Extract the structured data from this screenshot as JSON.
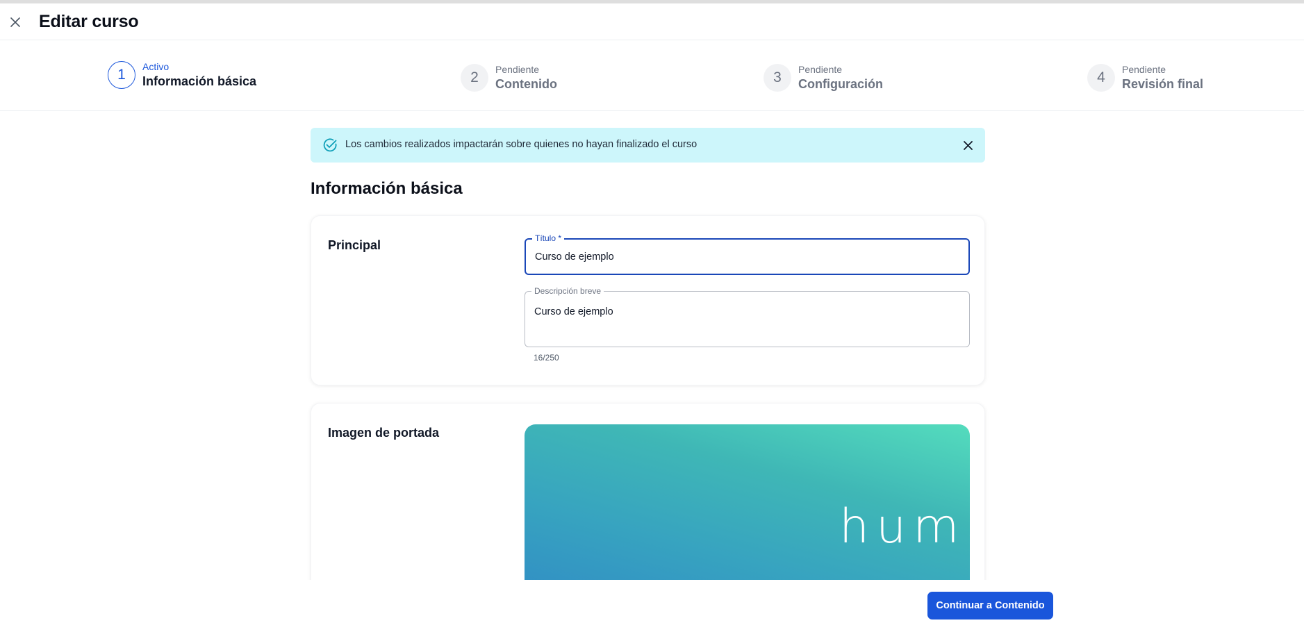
{
  "header": {
    "title": "Editar curso"
  },
  "stepper": {
    "steps": [
      {
        "number": "1",
        "status": "Activo",
        "label": "Información básica"
      },
      {
        "number": "2",
        "status": "Pendiente",
        "label": "Contenido"
      },
      {
        "number": "3",
        "status": "Pendiente",
        "label": "Configuración"
      },
      {
        "number": "4",
        "status": "Pendiente",
        "label": "Revisión final"
      }
    ]
  },
  "alert": {
    "message": "Los cambios realizados impactarán sobre quienes no hayan finalizado el curso"
  },
  "section": {
    "title": "Información básica"
  },
  "principal": {
    "label": "Principal",
    "title_field": {
      "legend": "Título *",
      "value": "Curso de ejemplo"
    },
    "description_field": {
      "legend": "Descripción breve",
      "value": "Curso de ejemplo",
      "counter": "16/250"
    }
  },
  "cover": {
    "label": "Imagen de portada",
    "image_text": "huma"
  },
  "footer": {
    "continue_label": "Continuar a Contenido"
  },
  "colors": {
    "primary": "#1a56db",
    "alert_bg": "#cdf6fb",
    "alert_icon": "#0e9fb8"
  }
}
